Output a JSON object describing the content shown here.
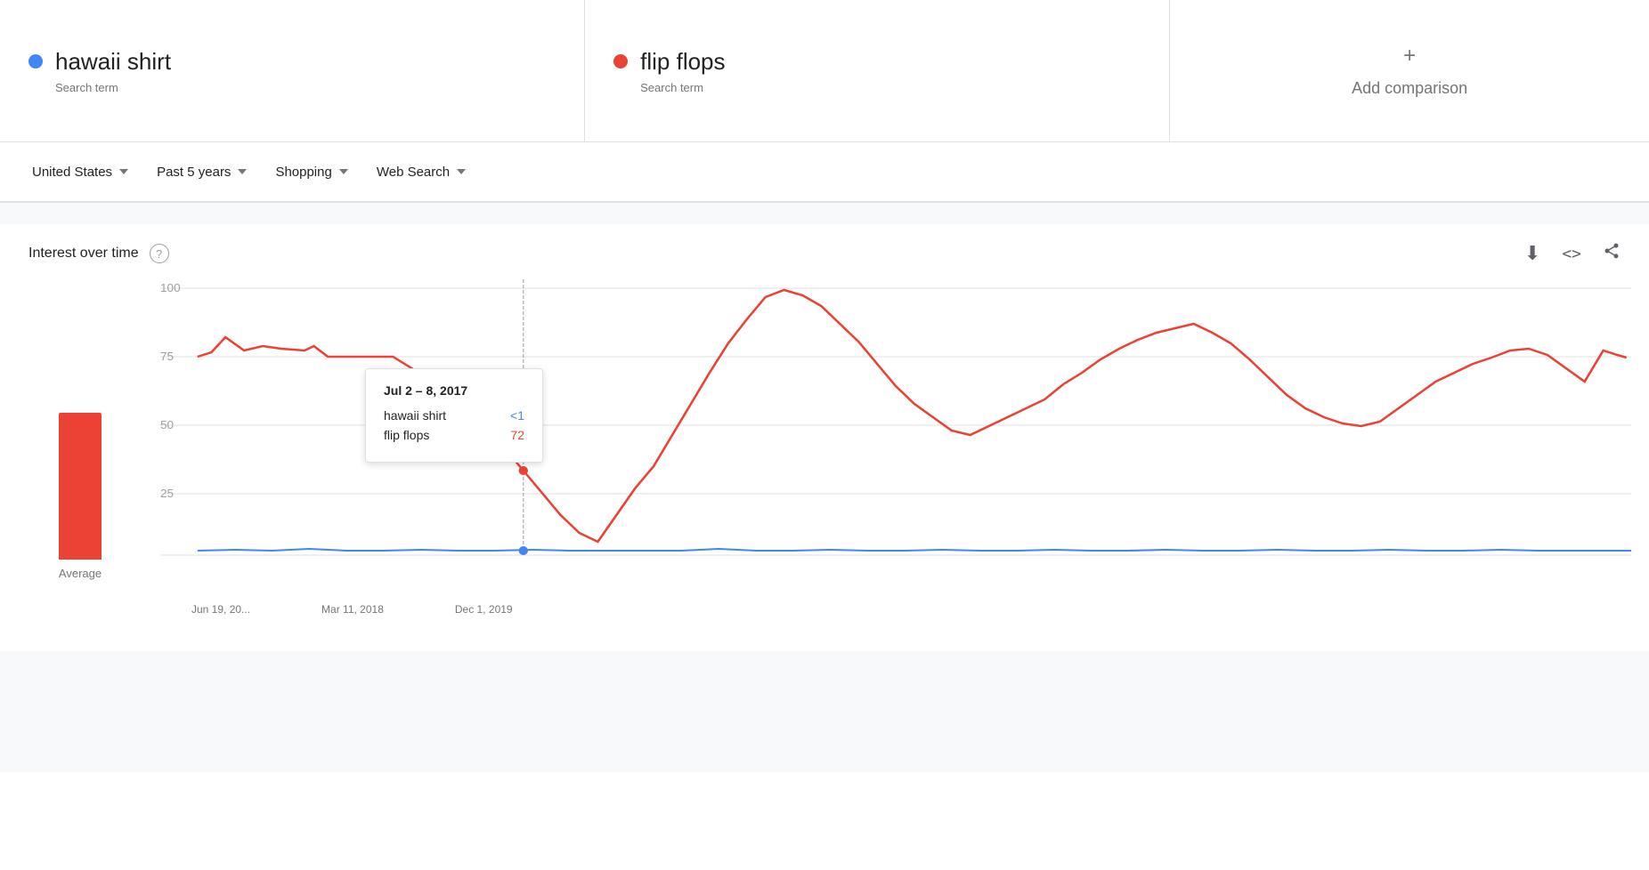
{
  "searchTerms": [
    {
      "id": "term1",
      "name": "hawaii shirt",
      "type": "Search term",
      "dotColor": "blue",
      "dotClass": "dot-blue"
    },
    {
      "id": "term2",
      "name": "flip flops",
      "type": "Search term",
      "dotColor": "red",
      "dotClass": "dot-red"
    }
  ],
  "addComparison": {
    "label": "Add comparison"
  },
  "filters": {
    "location": "United States",
    "timeRange": "Past 5 years",
    "category": "Shopping",
    "searchType": "Web Search"
  },
  "chart": {
    "title": "Interest over time",
    "helpTooltip": "?",
    "xLabels": [
      "Jun 19, 20...",
      "Mar 11, 2018",
      "Dec 1, 2019"
    ],
    "yLabels": [
      "100",
      "75",
      "50",
      "25"
    ],
    "avgLabel": "Average",
    "avgBarHeightPercent": 55,
    "tooltip": {
      "dateRange": "Jul 2 – 8, 2017",
      "rows": [
        {
          "term": "hawaii shirt",
          "value": "<1",
          "color": "blue"
        },
        {
          "term": "flip flops",
          "value": "72",
          "color": "red"
        }
      ]
    }
  },
  "icons": {
    "download": "⬇",
    "embed": "<>",
    "share": "⤴",
    "help": "?",
    "plus": "+"
  }
}
